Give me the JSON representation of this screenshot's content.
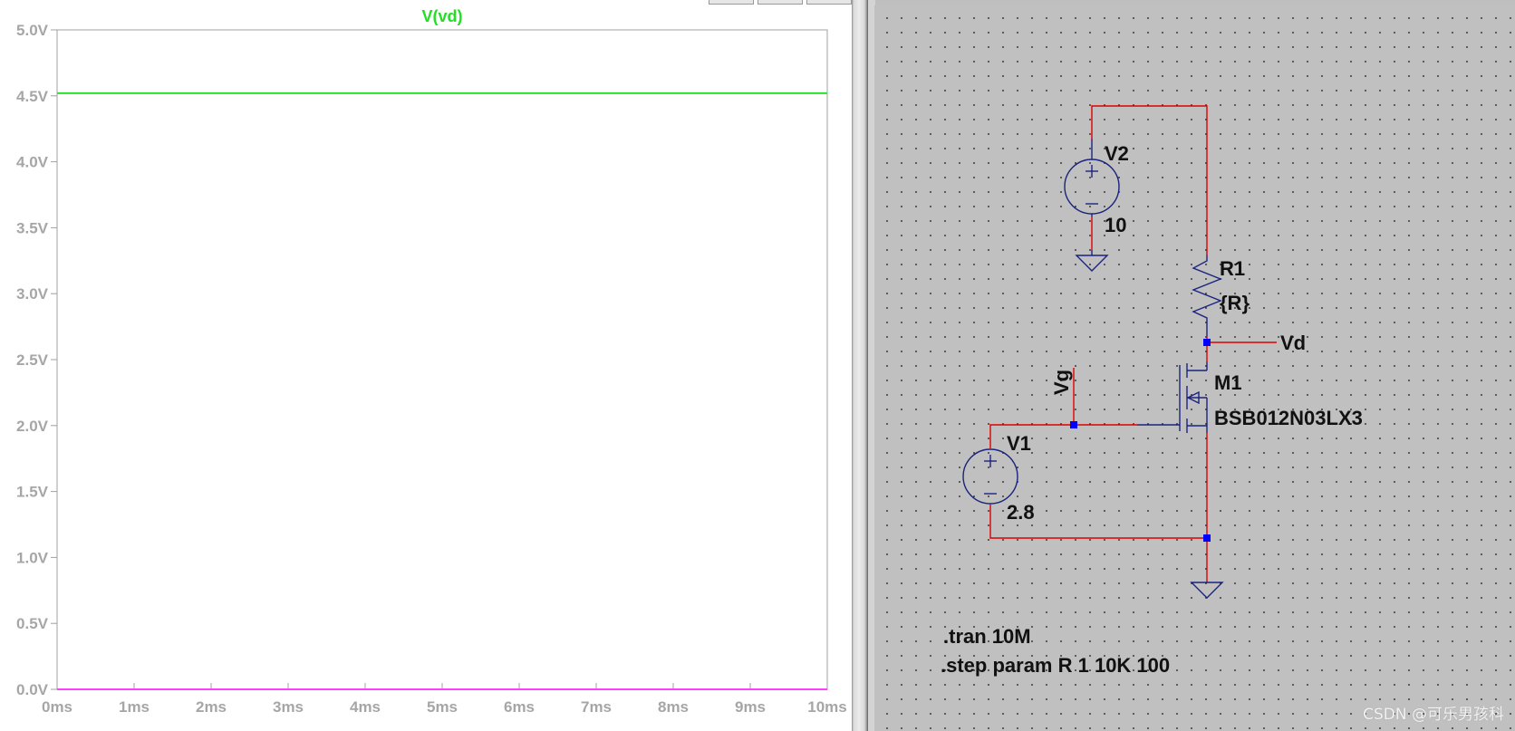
{
  "waveform": {
    "chart_data": {
      "type": "line",
      "title": "V(vd)",
      "xlabel": "",
      "ylabel": "",
      "x_ticks": [
        "0ms",
        "1ms",
        "2ms",
        "3ms",
        "4ms",
        "5ms",
        "6ms",
        "7ms",
        "8ms",
        "9ms",
        "10ms"
      ],
      "y_ticks": [
        "0.0V",
        "0.5V",
        "1.0V",
        "1.5V",
        "2.0V",
        "2.5V",
        "3.0V",
        "3.5V",
        "4.0V",
        "4.5V",
        "5.0V"
      ],
      "xlim": [
        0,
        10
      ],
      "ylim": [
        0,
        5
      ],
      "grid": false,
      "series": [
        {
          "color": "#2ee02e",
          "x": [
            0,
            10
          ],
          "y": [
            4.52,
            4.52
          ]
        },
        {
          "color": "#ff40ff",
          "x": [
            0,
            10
          ],
          "y": [
            0.0,
            0.0
          ]
        }
      ],
      "title_color": "#21e021"
    }
  },
  "schematic": {
    "v2": {
      "name": "V2",
      "value": "10"
    },
    "v1": {
      "name": "V1",
      "value": "2.8"
    },
    "r1": {
      "name": "R1",
      "value": "{R}"
    },
    "m1": {
      "name": "M1",
      "model": "BSB012N03LX3"
    },
    "net_vd": "Vd",
    "net_vg": "Vg",
    "directives": [
      ".tran 10M",
      ".step param R 1 10K 100"
    ],
    "colors": {
      "wire": "#e00000",
      "component": "#1a237e",
      "node": "#0000ff"
    }
  },
  "watermark": "CSDN @可乐男孩科"
}
